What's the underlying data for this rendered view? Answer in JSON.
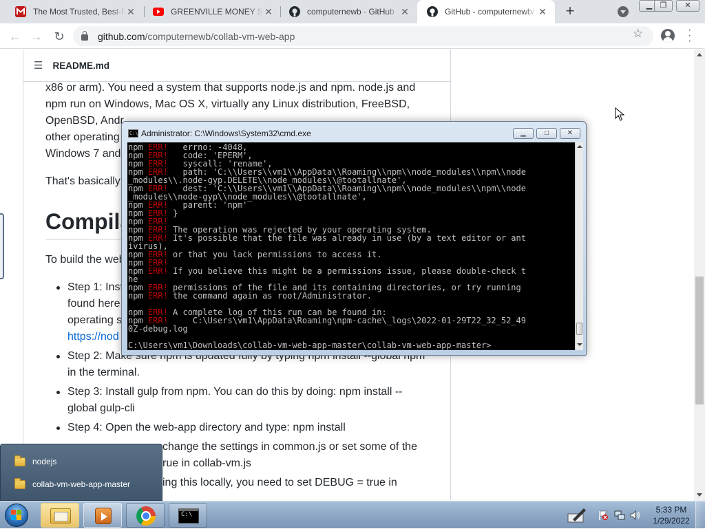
{
  "browser": {
    "tabs": [
      {
        "title": "The Most Trusted, Best-P",
        "favicon": "mcafee-icon",
        "active": false
      },
      {
        "title": "GREENVILLE MONEY SCR",
        "favicon": "youtube-icon",
        "active": false
      },
      {
        "title": "computernewb · GitHub",
        "favicon": "github-icon",
        "active": false
      },
      {
        "title": "GitHub - computernewb/",
        "favicon": "github-icon",
        "active": true
      }
    ],
    "url_host": "github.com",
    "url_path": "/computernewb/collab-vm-web-app"
  },
  "readme": {
    "filename": "README.md",
    "para1_lines": [
      "x86 or arm). You need a system that supports node.js and npm. node.js and",
      "npm run on Windows, Mac OS X, virtually any Linux distribution, FreeBSD,",
      "OpenBSD, Andr",
      "other operating",
      "Windows 7 and"
    ],
    "para2": "That's basically",
    "heading": "Compila",
    "para3": "To build the web",
    "steps": [
      {
        "lines": [
          "Step 1: Inst",
          "found here",
          "operating s"
        ],
        "link": "https://nod"
      },
      {
        "lines": [
          "Step 2: Make sure npm is updated fully by typing npm install --global npm",
          "in the terminal."
        ]
      },
      {
        "lines": [
          "Step 3: Install gulp from npm. You can do this by doing: npm install --",
          "global gulp-cli"
        ]
      },
      {
        "lines": [
          "Step 4: Open the web-app directory and type: npm install"
        ]
      },
      {
        "lines": [
          "change the settings in common.js or set some of the",
          "rue in collab-vm.js"
        ]
      },
      {
        "lines": [
          "ing this locally, you need to set DEBUG = true in"
        ]
      }
    ]
  },
  "cmd": {
    "title": "Administrator: C:\\Windows\\System32\\cmd.exe",
    "lines": [
      {
        "p": "npm ",
        "e": "ERR!",
        "t": "   errno: -4048,"
      },
      {
        "p": "npm ",
        "e": "ERR!",
        "t": "   code: 'EPERM',"
      },
      {
        "p": "npm ",
        "e": "ERR!",
        "t": "   syscall: 'rename',"
      },
      {
        "p": "npm ",
        "e": "ERR!",
        "t": "   path: 'C:\\\\Users\\\\vm1\\\\AppData\\\\Roaming\\\\npm\\\\node_modules\\\\npm\\\\node"
      },
      {
        "p": "",
        "e": "",
        "t": "_modules\\\\.node-gyp.DELETE\\\\node_modules\\\\@tootallnate',"
      },
      {
        "p": "npm ",
        "e": "ERR!",
        "t": "   dest: 'C:\\\\Users\\\\vm1\\\\AppData\\\\Roaming\\\\npm\\\\node_modules\\\\npm\\\\node"
      },
      {
        "p": "",
        "e": "",
        "t": "_modules\\\\node-gyp\\\\node_modules\\\\@tootallnate',"
      },
      {
        "p": "npm ",
        "e": "ERR!",
        "t": "   parent: 'npm'"
      },
      {
        "p": "npm ",
        "e": "ERR!",
        "t": " }"
      },
      {
        "p": "npm ",
        "e": "ERR!",
        "t": ""
      },
      {
        "p": "npm ",
        "e": "ERR!",
        "t": " The operation was rejected by your operating system."
      },
      {
        "p": "npm ",
        "e": "ERR!",
        "t": " It's possible that the file was already in use (by a text editor or ant"
      },
      {
        "p": "",
        "e": "",
        "t": "ivirus),"
      },
      {
        "p": "npm ",
        "e": "ERR!",
        "t": " or that you lack permissions to access it."
      },
      {
        "p": "npm ",
        "e": "ERR!",
        "t": ""
      },
      {
        "p": "npm ",
        "e": "ERR!",
        "t": " If you believe this might be a permissions issue, please double-check t"
      },
      {
        "p": "",
        "e": "",
        "t": "he"
      },
      {
        "p": "npm ",
        "e": "ERR!",
        "t": " permissions of the file and its containing directories, or try running"
      },
      {
        "p": "npm ",
        "e": "ERR!",
        "t": " the command again as root/Administrator."
      },
      {
        "p": "",
        "e": "",
        "t": ""
      },
      {
        "p": "npm ",
        "e": "ERR!",
        "t": " A complete log of this run can be found in:"
      },
      {
        "p": "npm ",
        "e": "ERR!",
        "t": "     C:\\Users\\vm1\\AppData\\Roaming\\npm-cache\\_logs\\2022-01-29T22_32_52_49"
      },
      {
        "p": "",
        "e": "",
        "t": "0Z-debug.log"
      },
      {
        "p": "",
        "e": "",
        "t": ""
      },
      {
        "p": "",
        "e": "",
        "t": "C:\\Users\\vm1\\Downloads\\collab-vm-web-app-master\\collab-vm-web-app-master>"
      }
    ]
  },
  "jumplist": {
    "items": [
      "nodejs",
      "collab-vm-web-app-master"
    ]
  },
  "taskbar": {
    "time": "5:33 PM",
    "date": "1/29/2022"
  },
  "colors": {
    "err_red": "#c00000",
    "link_blue": "#0969da",
    "console_text": "#c0c0c0"
  }
}
